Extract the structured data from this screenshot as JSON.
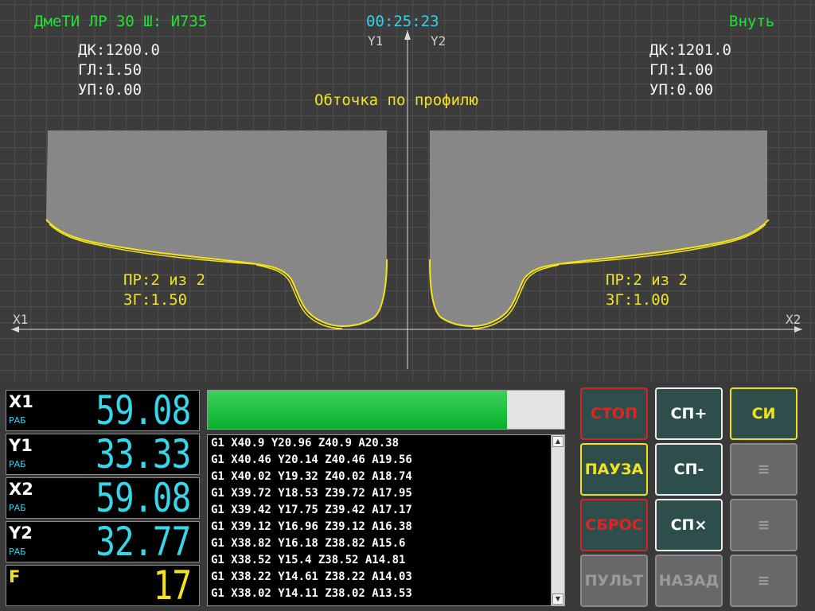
{
  "header": {
    "left": "ДмеТИ ЛР 30 Ш: И735",
    "clock": "00:25:23",
    "right": "Внуть"
  },
  "axes_labels": {
    "y1": "Y1",
    "y2": "Y2",
    "x1": "X1",
    "x2": "X2"
  },
  "left_info": {
    "dk": "ДК:1200.0",
    "gl": "ГЛ:1.50",
    "up": "УП:0.00",
    "pr": "ПР:2 из 2",
    "zg": "ЗГ:1.50"
  },
  "right_info": {
    "dk": "ДК:1201.0",
    "gl": "ГЛ:1.00",
    "up": "УП:0.00",
    "pr": "ПР:2 из 2",
    "zg": "ЗГ:1.00"
  },
  "operation": "Обточка по профилю",
  "readouts": [
    {
      "axis": "X1",
      "mode": "РАБ",
      "value": "59.08"
    },
    {
      "axis": "Y1",
      "mode": "РАБ",
      "value": "33.33"
    },
    {
      "axis": "X2",
      "mode": "РАБ",
      "value": "59.08"
    },
    {
      "axis": "Y2",
      "mode": "РАБ",
      "value": "32.77"
    },
    {
      "axis": "F",
      "mode": "",
      "value": "17"
    }
  ],
  "progress": 0.84,
  "gcode": [
    "G1 X40.9 Y20.96 Z40.9 A20.38",
    "G1 X40.46 Y20.14 Z40.46 A19.56",
    "G1 X40.02 Y19.32 Z40.02 A18.74",
    "G1 X39.72 Y18.53 Z39.72 A17.95",
    "G1 X39.42 Y17.75 Z39.42 A17.17",
    "G1 X39.12 Y16.96 Z39.12 A16.38",
    "G1 X38.82 Y16.18 Z38.82 A15.6",
    "G1 X38.52 Y15.4 Z38.52 A14.81",
    "G1 X38.22 Y14.61 Z38.22 A14.03",
    "G1 X38.02 Y14.11 Z38.02 A13.53"
  ],
  "buttons": {
    "stop": "СТОП",
    "sp_plus": "СП+",
    "si": "СИ",
    "pause": "ПАУЗА",
    "sp_minus": "СП-",
    "reset": "СБРОС",
    "sp_x": "СП×",
    "pult": "ПУЛЬТ",
    "back": "НАЗАД",
    "menu_icon": "≡"
  },
  "colors": {
    "header": "#22e035",
    "clock": "#38d0e8",
    "profile": "#f3e21c",
    "readout": "#36d7ea",
    "feed": "#f3e21c"
  }
}
